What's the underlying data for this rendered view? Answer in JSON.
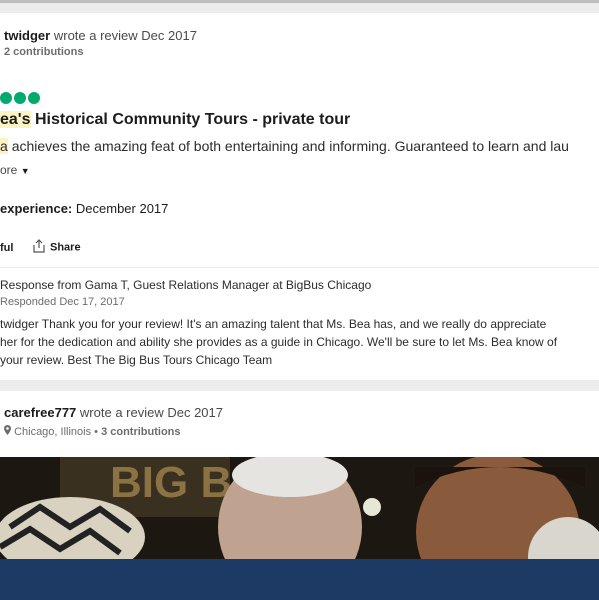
{
  "review1": {
    "username": "twidger",
    "action": "wrote a review Dec 2017",
    "contributions": "2 contributions",
    "rating_dots": 3,
    "title_highlight": "ea's",
    "title_rest": "Historical Community Tours - private tour",
    "body_highlight": "a",
    "body_rest": "achieves the amazing feat of both entertaining and informing. Guaranteed to learn and lau",
    "more_label": "ore",
    "experience_label": "experience:",
    "experience_value": "December 2017",
    "helpful_label": "ful",
    "share_label": "Share"
  },
  "response": {
    "header": "Response from Gama T, Guest Relations Manager at BigBus Chicago",
    "date": "Responded Dec 17, 2017",
    "lines": [
      "twidger Thank you for your review! It's an amazing talent that Ms. Bea has, and we really do appreciate",
      "her for the dedication and ability she provides as a guide in Chicago. We'll be sure to let Ms. Bea know of",
      "your review. Best The Big Bus Tours Chicago Team"
    ]
  },
  "review2": {
    "username": "carefree777",
    "action": "wrote a review Dec 2017",
    "location": "Chicago, Illinois",
    "contributions": "3 contributions",
    "photo_sign_text": "BIG B"
  },
  "colors": {
    "rating_green": "#00aa6c",
    "highlight_yellow": "#fcf3c4",
    "navy_bar": "#1c3a63"
  }
}
